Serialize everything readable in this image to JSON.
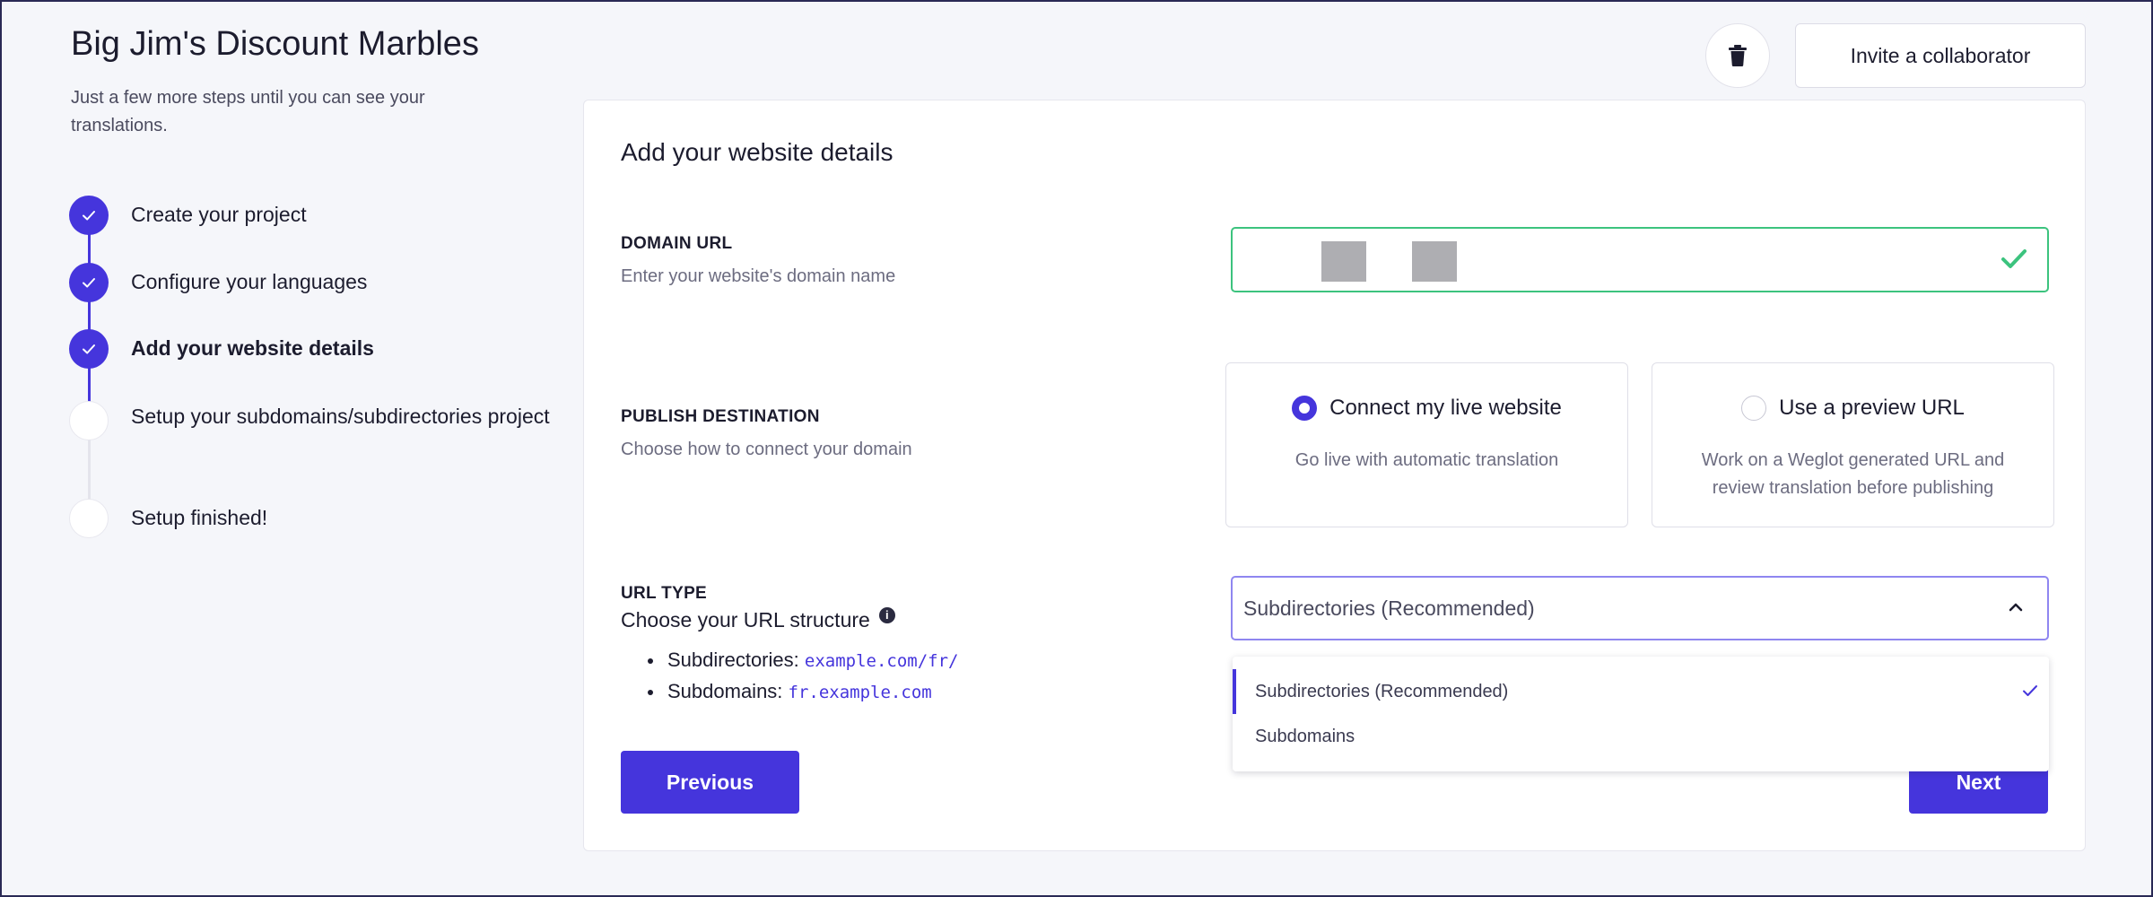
{
  "project": {
    "title": "Big Jim's Discount Marbles",
    "subtitle": "Just a few more steps until you can see your translations."
  },
  "steps": [
    {
      "label": "Create your project",
      "status": "done"
    },
    {
      "label": "Configure your languages",
      "status": "done"
    },
    {
      "label": "Add your website details",
      "status": "current"
    },
    {
      "label": "Setup your subdomains/subdirectories project",
      "status": "todo"
    },
    {
      "label": "Setup finished!",
      "status": "todo"
    }
  ],
  "header": {
    "delete_icon": "trash-icon",
    "invite_label": "Invite a collaborator"
  },
  "card": {
    "title": "Add your website details",
    "domain": {
      "label": "DOMAIN URL",
      "help": "Enter your website's domain name",
      "value": "",
      "valid": true
    },
    "publish": {
      "label": "PUBLISH DESTINATION",
      "help": "Choose how to connect your domain",
      "options": [
        {
          "title": "Connect my live website",
          "desc": "Go live with automatic translation",
          "selected": true
        },
        {
          "title": "Use a preview URL",
          "desc": "Work on a Weglot generated URL and review translation before publishing",
          "selected": false
        }
      ]
    },
    "url_type": {
      "label": "URL TYPE",
      "help": "Choose your URL structure",
      "info_icon": "i",
      "examples": [
        {
          "name": "Subdirectories:",
          "example": "example.com/fr/"
        },
        {
          "name": "Subdomains:",
          "example": "fr.example.com"
        }
      ],
      "selected": "Subdirectories (Recommended)",
      "options": [
        "Subdirectories (Recommended)",
        "Subdomains"
      ]
    },
    "previous_label": "Previous",
    "next_label": "Next"
  },
  "colors": {
    "accent": "#4535dc",
    "success": "#3cc37e",
    "background": "#f5f6fa"
  }
}
